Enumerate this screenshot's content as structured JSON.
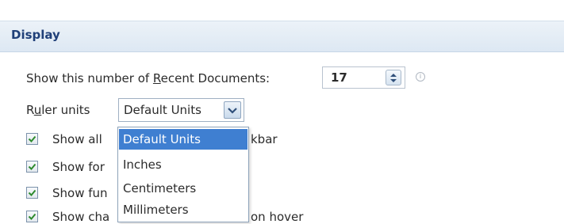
{
  "display_section": {
    "title": "Display"
  },
  "recent_documents": {
    "label_pre": "Show this number of ",
    "label_accel": "R",
    "label_post": "ecent Documents:",
    "value": "17"
  },
  "ruler_units": {
    "label_pre": "R",
    "label_accel": "u",
    "label_post": "ler units",
    "selected": "Default Units",
    "options": [
      "Default Units",
      "Inches",
      "Centimeters",
      "Millimeters"
    ]
  },
  "checkboxes": [
    {
      "visible_left": "Show all",
      "visible_right": "kbar",
      "checked": true
    },
    {
      "visible_left": "Show for",
      "checked": true
    },
    {
      "visible_left": "Show fun",
      "checked": true
    },
    {
      "visible_left": "Show cha",
      "visible_right": "on hover",
      "checked": true
    }
  ]
}
